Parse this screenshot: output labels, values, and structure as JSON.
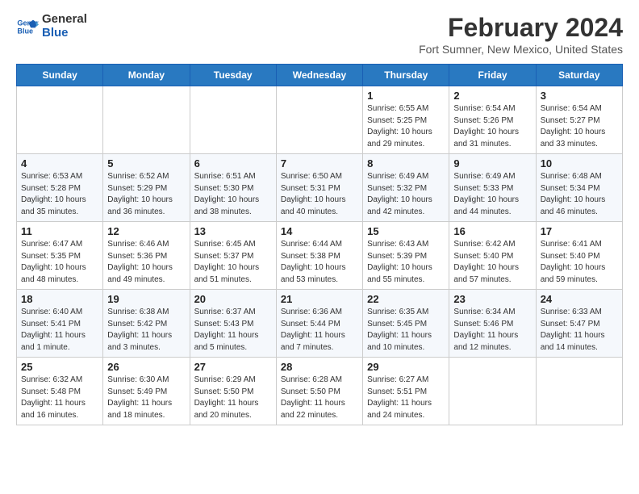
{
  "logo": {
    "line1": "General",
    "line2": "Blue"
  },
  "title": "February 2024",
  "subtitle": "Fort Sumner, New Mexico, United States",
  "days_of_week": [
    "Sunday",
    "Monday",
    "Tuesday",
    "Wednesday",
    "Thursday",
    "Friday",
    "Saturday"
  ],
  "weeks": [
    [
      {
        "day": "",
        "detail": ""
      },
      {
        "day": "",
        "detail": ""
      },
      {
        "day": "",
        "detail": ""
      },
      {
        "day": "",
        "detail": ""
      },
      {
        "day": "1",
        "detail": "Sunrise: 6:55 AM\nSunset: 5:25 PM\nDaylight: 10 hours\nand 29 minutes."
      },
      {
        "day": "2",
        "detail": "Sunrise: 6:54 AM\nSunset: 5:26 PM\nDaylight: 10 hours\nand 31 minutes."
      },
      {
        "day": "3",
        "detail": "Sunrise: 6:54 AM\nSunset: 5:27 PM\nDaylight: 10 hours\nand 33 minutes."
      }
    ],
    [
      {
        "day": "4",
        "detail": "Sunrise: 6:53 AM\nSunset: 5:28 PM\nDaylight: 10 hours\nand 35 minutes."
      },
      {
        "day": "5",
        "detail": "Sunrise: 6:52 AM\nSunset: 5:29 PM\nDaylight: 10 hours\nand 36 minutes."
      },
      {
        "day": "6",
        "detail": "Sunrise: 6:51 AM\nSunset: 5:30 PM\nDaylight: 10 hours\nand 38 minutes."
      },
      {
        "day": "7",
        "detail": "Sunrise: 6:50 AM\nSunset: 5:31 PM\nDaylight: 10 hours\nand 40 minutes."
      },
      {
        "day": "8",
        "detail": "Sunrise: 6:49 AM\nSunset: 5:32 PM\nDaylight: 10 hours\nand 42 minutes."
      },
      {
        "day": "9",
        "detail": "Sunrise: 6:49 AM\nSunset: 5:33 PM\nDaylight: 10 hours\nand 44 minutes."
      },
      {
        "day": "10",
        "detail": "Sunrise: 6:48 AM\nSunset: 5:34 PM\nDaylight: 10 hours\nand 46 minutes."
      }
    ],
    [
      {
        "day": "11",
        "detail": "Sunrise: 6:47 AM\nSunset: 5:35 PM\nDaylight: 10 hours\nand 48 minutes."
      },
      {
        "day": "12",
        "detail": "Sunrise: 6:46 AM\nSunset: 5:36 PM\nDaylight: 10 hours\nand 49 minutes."
      },
      {
        "day": "13",
        "detail": "Sunrise: 6:45 AM\nSunset: 5:37 PM\nDaylight: 10 hours\nand 51 minutes."
      },
      {
        "day": "14",
        "detail": "Sunrise: 6:44 AM\nSunset: 5:38 PM\nDaylight: 10 hours\nand 53 minutes."
      },
      {
        "day": "15",
        "detail": "Sunrise: 6:43 AM\nSunset: 5:39 PM\nDaylight: 10 hours\nand 55 minutes."
      },
      {
        "day": "16",
        "detail": "Sunrise: 6:42 AM\nSunset: 5:40 PM\nDaylight: 10 hours\nand 57 minutes."
      },
      {
        "day": "17",
        "detail": "Sunrise: 6:41 AM\nSunset: 5:40 PM\nDaylight: 10 hours\nand 59 minutes."
      }
    ],
    [
      {
        "day": "18",
        "detail": "Sunrise: 6:40 AM\nSunset: 5:41 PM\nDaylight: 11 hours\nand 1 minute."
      },
      {
        "day": "19",
        "detail": "Sunrise: 6:38 AM\nSunset: 5:42 PM\nDaylight: 11 hours\nand 3 minutes."
      },
      {
        "day": "20",
        "detail": "Sunrise: 6:37 AM\nSunset: 5:43 PM\nDaylight: 11 hours\nand 5 minutes."
      },
      {
        "day": "21",
        "detail": "Sunrise: 6:36 AM\nSunset: 5:44 PM\nDaylight: 11 hours\nand 7 minutes."
      },
      {
        "day": "22",
        "detail": "Sunrise: 6:35 AM\nSunset: 5:45 PM\nDaylight: 11 hours\nand 10 minutes."
      },
      {
        "day": "23",
        "detail": "Sunrise: 6:34 AM\nSunset: 5:46 PM\nDaylight: 11 hours\nand 12 minutes."
      },
      {
        "day": "24",
        "detail": "Sunrise: 6:33 AM\nSunset: 5:47 PM\nDaylight: 11 hours\nand 14 minutes."
      }
    ],
    [
      {
        "day": "25",
        "detail": "Sunrise: 6:32 AM\nSunset: 5:48 PM\nDaylight: 11 hours\nand 16 minutes."
      },
      {
        "day": "26",
        "detail": "Sunrise: 6:30 AM\nSunset: 5:49 PM\nDaylight: 11 hours\nand 18 minutes."
      },
      {
        "day": "27",
        "detail": "Sunrise: 6:29 AM\nSunset: 5:50 PM\nDaylight: 11 hours\nand 20 minutes."
      },
      {
        "day": "28",
        "detail": "Sunrise: 6:28 AM\nSunset: 5:50 PM\nDaylight: 11 hours\nand 22 minutes."
      },
      {
        "day": "29",
        "detail": "Sunrise: 6:27 AM\nSunset: 5:51 PM\nDaylight: 11 hours\nand 24 minutes."
      },
      {
        "day": "",
        "detail": ""
      },
      {
        "day": "",
        "detail": ""
      }
    ]
  ]
}
